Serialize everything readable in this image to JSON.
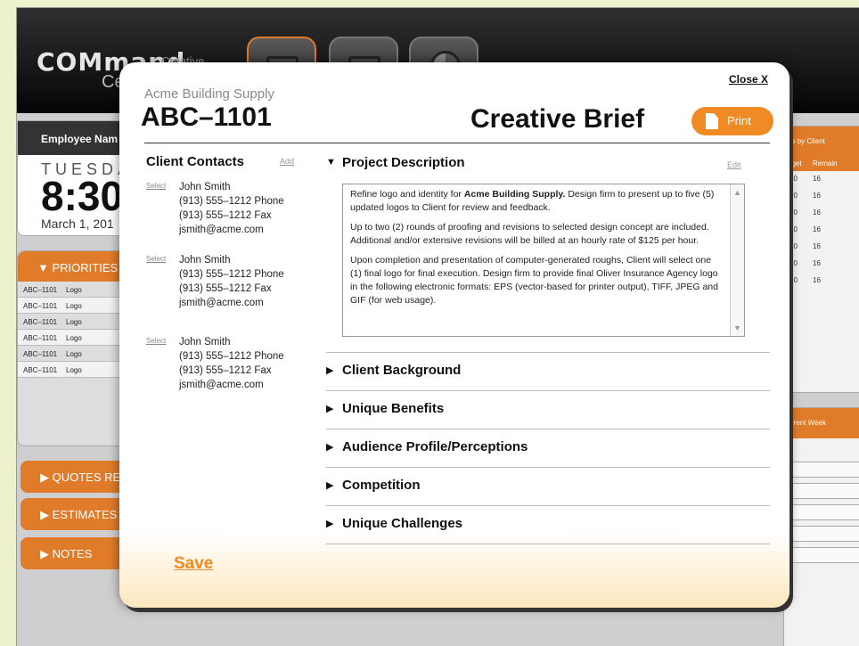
{
  "background": {
    "logo_main": "COMmand",
    "logo_creative": "Creative",
    "logo_sub": "Ce",
    "employee": {
      "header": "Employee Nam",
      "day": "TUESDA",
      "time": "8:30",
      "date": "March 1, 201"
    },
    "priorities": {
      "header": "▼ PRIORITIES",
      "rows": [
        {
          "job": "ABC–1101",
          "text": "Logo"
        },
        {
          "job": "ABC–1101",
          "text": "Logo"
        },
        {
          "job": "ABC–1101",
          "text": "Logo"
        },
        {
          "job": "ABC–1101",
          "text": "Logo"
        },
        {
          "job": "ABC–1101",
          "text": "Logo"
        },
        {
          "job": "ABC–1101",
          "text": "Logo"
        }
      ]
    },
    "side_tabs": [
      "▶ QUOTES RE",
      "▶ ESTIMATES",
      "▶ NOTES"
    ],
    "right_panel": {
      "header": "e by Client",
      "col_budget": "dget",
      "col_remain": "Remain",
      "rows": [
        {
          "budget": "20",
          "remain": "16"
        },
        {
          "budget": "20",
          "remain": "16"
        },
        {
          "budget": "20",
          "remain": "16"
        },
        {
          "budget": "20",
          "remain": "16"
        },
        {
          "budget": "20",
          "remain": "16"
        },
        {
          "budget": "20",
          "remain": "16"
        },
        {
          "budget": "20",
          "remain": "16"
        }
      ]
    },
    "right_panel2": {
      "header": "rrent Week"
    }
  },
  "modal": {
    "close_label": "Close X",
    "client_name": "Acme Building Supply",
    "job_number": "ABC–1101",
    "title": "Creative Brief",
    "print_label": "Print",
    "save_label": "Save",
    "contacts": {
      "heading": "Client Contacts",
      "add_label": "Add",
      "select_label": "Select",
      "items": [
        {
          "name": "John Smith",
          "phone": "(913) 555–1212  Phone",
          "fax": "(913) 555–1212  Fax",
          "email": "jsmith@acme.com"
        },
        {
          "name": "John Smith",
          "phone": "(913) 555–1212  Phone",
          "fax": "(913) 555–1212  Fax",
          "email": "jsmith@acme.com"
        },
        {
          "name": "John Smith",
          "phone": "(913) 555–1212  Phone",
          "fax": "(913) 555–1212  Fax",
          "email": "jsmith@acme.com"
        }
      ]
    },
    "project_description": {
      "heading": "Project Description",
      "edit_label": "Edit",
      "p1_prefix": "Refine logo and identity for ",
      "p1_bold": "Acme Building Supply.",
      "p1_suffix": " Design firm to present up to five (5) updated logos to Client for review and feedback.",
      "p2": "Up to two (2) rounds of proofing and revisions to selected design concept are included. Additional and/or extensive revisions will be billed at an hourly rate of $125 per hour.",
      "p3": "Upon completion and presentation of computer-generated roughs, Client will select one (1) final logo for final execution. Design firm to provide final Oliver Insurance Agency logo in the following electronic formats: EPS (vector-based for printer output), TIFF, JPEG and GIF (for web usage)."
    },
    "sections": [
      "Client Background",
      "Unique Benefits",
      "Audience Profile/Perceptions",
      "Competition",
      "Unique Challenges"
    ]
  }
}
